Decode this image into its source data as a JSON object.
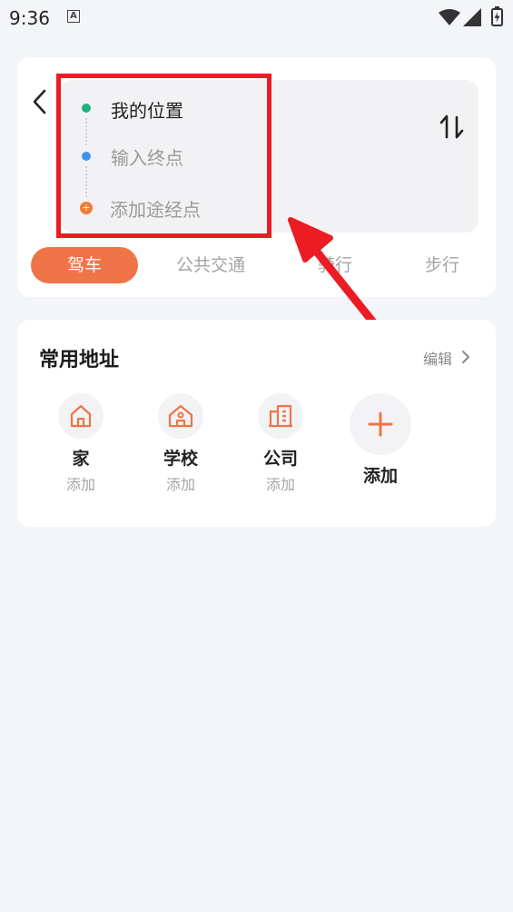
{
  "status_bar": {
    "time": "9:36",
    "notification_icon": "A"
  },
  "route": {
    "my_location": "我的位置",
    "destination_placeholder": "输入终点",
    "add_waypoint": "添加途经点",
    "waypoint_marker": "+"
  },
  "tabs": [
    {
      "label": "驾车",
      "active": true
    },
    {
      "label": "公共交通",
      "active": false
    },
    {
      "label": "骑行",
      "active": false
    },
    {
      "label": "步行",
      "active": false
    }
  ],
  "common_address": {
    "title": "常用地址",
    "edit_label": "编辑",
    "items": [
      {
        "name": "家",
        "sub": "添加",
        "icon": "home-icon"
      },
      {
        "name": "学校",
        "sub": "添加",
        "icon": "school-icon"
      },
      {
        "name": "公司",
        "sub": "添加",
        "icon": "office-icon"
      }
    ],
    "add_label": "添加"
  },
  "colors": {
    "accent": "#ef7448",
    "highlight": "#ec1c24",
    "start_dot": "#1fb37c",
    "end_dot": "#3d92f5",
    "via_dot": "#f47b30"
  }
}
